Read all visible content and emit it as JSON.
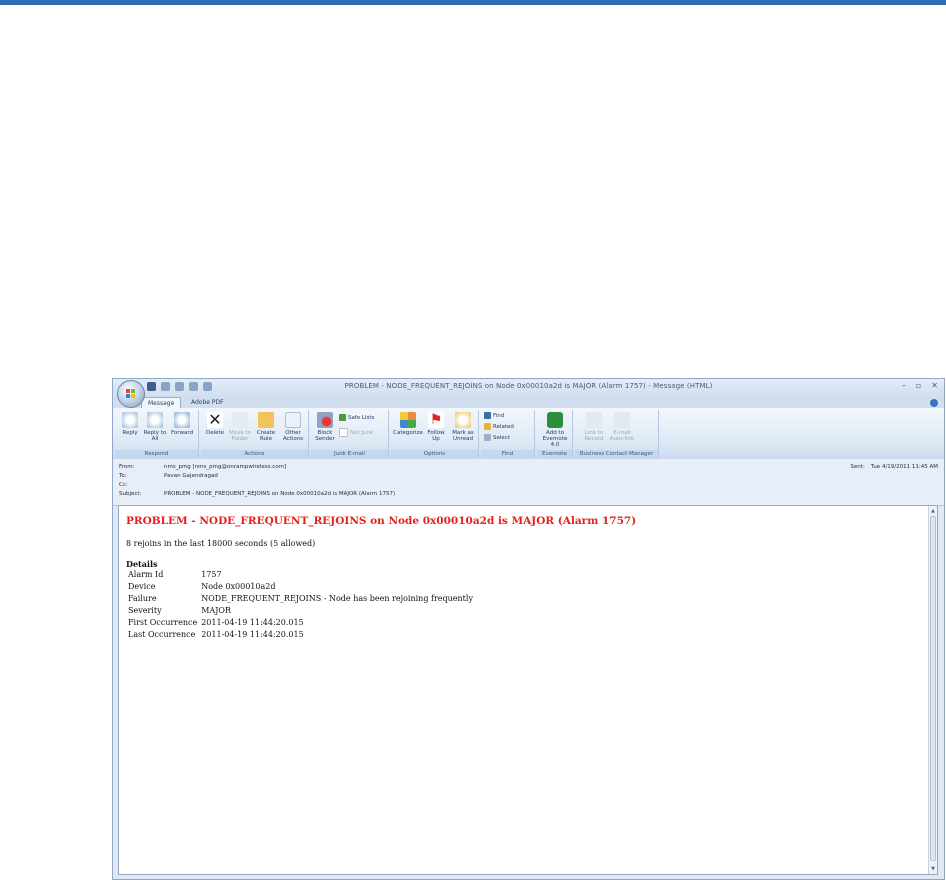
{
  "window": {
    "title": "PROBLEM - NODE_FREQUENT_REJOINS on Node 0x00010a2d is MAJOR (Alarm 1757) - Message (HTML)",
    "controls": [
      "–",
      "▫",
      "✕"
    ]
  },
  "tabs": [
    "Message",
    "Adobe PDF"
  ],
  "ribbon": {
    "respond": {
      "label": "Respond",
      "buttons": [
        "Reply",
        "Reply to All",
        "Forward"
      ]
    },
    "actions": {
      "label": "Actions",
      "buttons": [
        "Delete",
        "Move to Folder",
        "Create Rule",
        "Other Actions"
      ]
    },
    "junk": {
      "label": "Junk E-mail",
      "block_sender": "Block Sender",
      "safe_lists": "Safe Lists",
      "not_junk": "Not Junk"
    },
    "options": {
      "label": "Options",
      "buttons": [
        "Categorize",
        "Follow Up",
        "Mark as Unread"
      ]
    },
    "find": {
      "label": "Find",
      "find": "Find",
      "related": "Related",
      "select": "Select"
    },
    "evernote": {
      "label": "Evernote",
      "add": "Add to Evernote 4.0"
    },
    "bcm": {
      "label": "Business Contact Manager",
      "buttons": [
        "Link to Record",
        "E-mail Auto-link"
      ]
    }
  },
  "header": {
    "from_label": "From:",
    "from_value": "nms_pmg [nms_pmg@onrampwireless.com]",
    "to_label": "To:",
    "to_value": "Pavan Gajendragad",
    "cc_label": "Cc:",
    "cc_value": "",
    "subject_label": "Subject:",
    "subject_value": "PROBLEM - NODE_FREQUENT_REJOINS on Node 0x00010a2d is MAJOR (Alarm 1757)",
    "sent_label": "Sent:",
    "sent_value": "Tue 4/19/2011 11:45 AM"
  },
  "message": {
    "title": "PROBLEM - NODE_FREQUENT_REJOINS on Node 0x00010a2d is MAJOR (Alarm 1757)",
    "summary": "8 rejoins in the last 18000 seconds (5 allowed)",
    "details_heading": "Details",
    "details": [
      {
        "key": "Alarm Id",
        "value": "1757"
      },
      {
        "key": "Device",
        "value": "Node 0x00010a2d"
      },
      {
        "key": "Failure",
        "value": "NODE_FREQUENT_REJOINS - Node has been rejoining frequently"
      },
      {
        "key": "Severity",
        "value": "MAJOR"
      },
      {
        "key": "First Occurrence",
        "value": "2011-04-19 11:44:20.015"
      },
      {
        "key": "Last Occurrence",
        "value": "2011-04-19 11:44:20.015"
      }
    ]
  },
  "colors": {
    "accent": "#2f6fb4",
    "alert_red": "#e8201c"
  }
}
